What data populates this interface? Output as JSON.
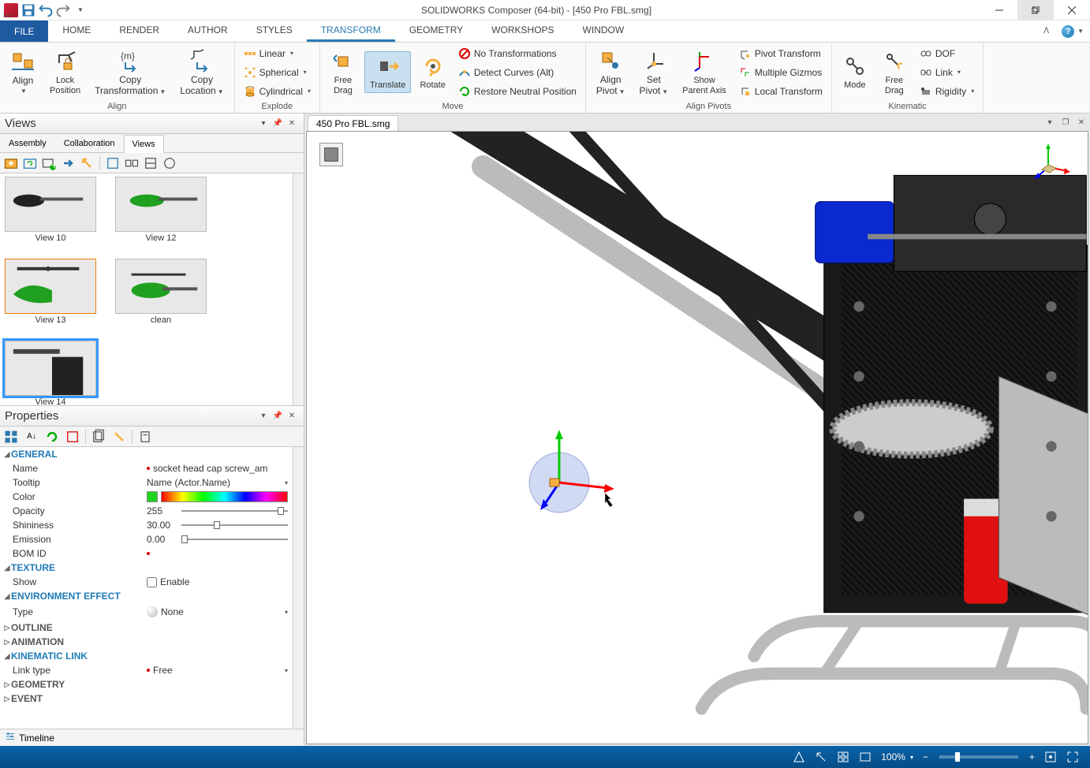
{
  "title": "SOLIDWORKS Composer (64-bit) - [450 Pro FBL.smg]",
  "menu": {
    "file": "FILE",
    "tabs": [
      "HOME",
      "RENDER",
      "AUTHOR",
      "STYLES",
      "TRANSFORM",
      "GEOMETRY",
      "WORKSHOPS",
      "WINDOW"
    ],
    "active": "TRANSFORM"
  },
  "ribbon": {
    "align": {
      "label": "Align",
      "align_btn": "Align",
      "lock_btn": "Lock\nPosition",
      "copy_trans": "Copy\nTransformation",
      "copy_loc": "Copy\nLocation"
    },
    "explode": {
      "label": "Explode",
      "linear": "Linear",
      "spherical": "Spherical",
      "cylindrical": "Cylindrical"
    },
    "move": {
      "label": "Move",
      "free_drag": "Free\nDrag",
      "translate": "Translate",
      "rotate": "Rotate",
      "no_trans": "No Transformations",
      "detect": "Detect Curves (Alt)",
      "restore": "Restore Neutral Position"
    },
    "align_pivots": {
      "label": "Align Pivots",
      "align_pivot": "Align\nPivot",
      "set_pivot": "Set\nPivot",
      "show_parent": "Show\nParent Axis",
      "pivot_trans": "Pivot Transform",
      "multi_gizmos": "Multiple Gizmos",
      "local_trans": "Local Transform"
    },
    "kinematic": {
      "label": "Kinematic",
      "mode": "Mode",
      "free_drag": "Free\nDrag",
      "dof": "DOF",
      "link": "Link",
      "rigidity": "Rigidity"
    }
  },
  "views_panel": {
    "title": "Views",
    "tabs": [
      "Assembly",
      "Collaboration",
      "Views"
    ],
    "active_tab": "Views",
    "views": [
      {
        "label": "View 10"
      },
      {
        "label": "View 12"
      },
      {
        "label": "View 13"
      },
      {
        "label": "clean"
      },
      {
        "label": "View 14",
        "selected": true
      }
    ]
  },
  "properties_panel": {
    "title": "Properties",
    "general": {
      "cat": "GENERAL",
      "name_label": "Name",
      "name_value": "socket head cap screw_am",
      "tooltip_label": "Tooltip",
      "tooltip_value": "Name (Actor.Name)",
      "color_label": "Color",
      "opacity_label": "Opacity",
      "opacity_value": "255",
      "shininess_label": "Shininess",
      "shininess_value": "30.00",
      "emission_label": "Emission",
      "emission_value": "0.00",
      "bomid_label": "BOM ID"
    },
    "texture": {
      "cat": "TEXTURE",
      "show_label": "Show",
      "enable": "Enable"
    },
    "environment": {
      "cat": "ENVIRONMENT EFFECT",
      "type_label": "Type",
      "type_value": "None"
    },
    "outline": "OUTLINE",
    "animation": "ANIMATION",
    "kinematic_link": {
      "cat": "KINEMATIC LINK",
      "linktype_label": "Link type",
      "linktype_value": "Free"
    },
    "geometry": "GEOMETRY",
    "event": "EVENT"
  },
  "timeline": "Timeline",
  "doc_tab": "450 Pro FBL.smg",
  "statusbar": {
    "zoom": "100%"
  }
}
